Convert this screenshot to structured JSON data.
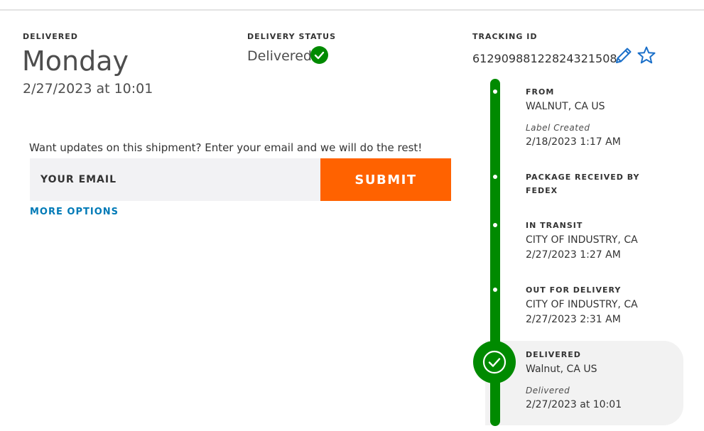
{
  "header": {
    "delivered_label": "DELIVERED",
    "day": "Monday",
    "datetime": "2/27/2023 at 10:01"
  },
  "status": {
    "label": "DELIVERY STATUS",
    "value": "Delivered"
  },
  "tracking": {
    "label": "TRACKING ID",
    "number": "61290988122824321508"
  },
  "updates": {
    "prompt": "Want updates on this shipment? Enter your email and we will do the rest!",
    "email_placeholder": "YOUR EMAIL",
    "submit_label": "SUBMIT",
    "more_options_label": "MORE OPTIONS"
  },
  "timeline": {
    "from": {
      "title": "FROM",
      "location": "WALNUT, CA US",
      "note": "Label Created",
      "time": "2/18/2023 1:17 AM"
    },
    "received": {
      "title_line1": "PACKAGE RECEIVED BY",
      "title_line2": "FEDEX"
    },
    "in_transit": {
      "title": "IN TRANSIT",
      "location": "CITY OF INDUSTRY, CA",
      "time": "2/27/2023 1:27 AM"
    },
    "out_for_delivery": {
      "title": "OUT FOR DELIVERY",
      "location": "CITY OF INDUSTRY, CA",
      "time": "2/27/2023 2:31 AM"
    },
    "delivered": {
      "title": "DELIVERED",
      "location": "Walnut, CA US",
      "note": "Delivered",
      "time": "2/27/2023 at 10:01"
    }
  },
  "colors": {
    "accent_green": "#008a00",
    "submit_orange": "#ff6200",
    "link_blue": "#007ab7",
    "icon_blue": "#1a6fc9"
  }
}
